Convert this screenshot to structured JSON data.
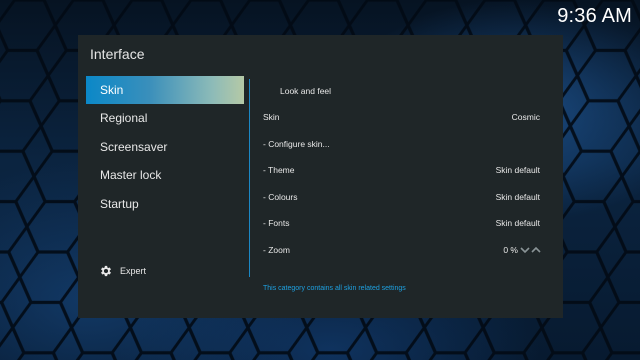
{
  "clock": "9:36 AM",
  "dialog": {
    "title": "Interface"
  },
  "categories": [
    {
      "label": "Skin",
      "active": true
    },
    {
      "label": "Regional",
      "active": false
    },
    {
      "label": "Screensaver",
      "active": false
    },
    {
      "label": "Master lock",
      "active": false
    },
    {
      "label": "Startup",
      "active": false
    }
  ],
  "settings_level": {
    "label": "Expert",
    "icon": "gear-icon"
  },
  "settings": {
    "group_header": "Look and feel",
    "rows": [
      {
        "label": "Skin",
        "value": "Cosmic"
      },
      {
        "label": "- Configure skin...",
        "value": ""
      },
      {
        "label": "- Theme",
        "value": "Skin default"
      },
      {
        "label": "- Colours",
        "value": "Skin default"
      },
      {
        "label": "- Fonts",
        "value": "Skin default"
      },
      {
        "label": "- Zoom",
        "value": "0 %",
        "icon": "chevron-spinner-icon"
      }
    ]
  },
  "help_text": "This category contains all skin related settings",
  "colors": {
    "accent": "#1b87c4",
    "panel": "#1f2628",
    "help_text": "#1ea0e0"
  }
}
